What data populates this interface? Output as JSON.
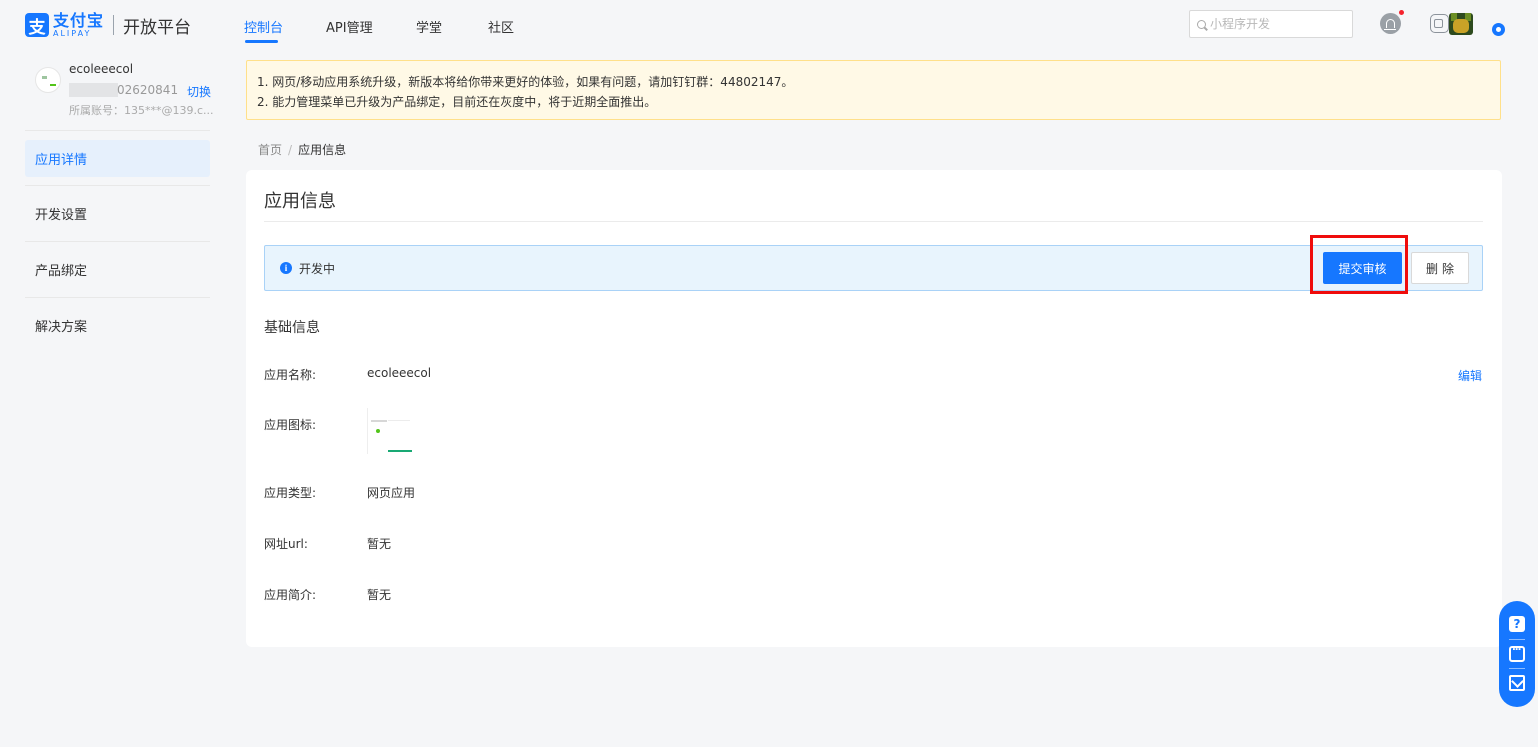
{
  "header": {
    "logo_cn": "支付宝",
    "logo_en": "ALIPAY",
    "logo_mark": "支",
    "platform": "开放平台",
    "nav": [
      {
        "label": "控制台",
        "active": true
      },
      {
        "label": "API管理",
        "active": false
      },
      {
        "label": "学堂",
        "active": false
      },
      {
        "label": "社区",
        "active": false
      }
    ],
    "search_placeholder": "小程序开发",
    "icons": [
      "search-icon",
      "bell-icon",
      "id-card-icon",
      "user-avatar",
      "help-icon"
    ]
  },
  "account": {
    "name": "ecoleeecol",
    "id": "02620841",
    "switch_label": "切换",
    "owner": "所属账号：135***@139.c..."
  },
  "sidebar": {
    "items": [
      {
        "label": "应用详情",
        "active": true
      },
      {
        "label": "开发设置",
        "active": false
      },
      {
        "label": "产品绑定",
        "active": false
      },
      {
        "label": "解决方案",
        "active": false
      }
    ]
  },
  "notice": {
    "lines": [
      "1. 网页/移动应用系统升级，新版本将给你带来更好的体验，如果有问题，请加钉钉群：44802147。",
      "2. 能力管理菜单已升级为产品绑定，目前还在灰度中，将于近期全面推出。"
    ]
  },
  "breadcrumb": {
    "home": "首页",
    "separator": "/",
    "current": "应用信息"
  },
  "main": {
    "title": "应用信息",
    "status": {
      "icon": "info-icon",
      "icon_glyph": "i",
      "text": "开发中",
      "submit_label": "提交审核",
      "delete_label": "删除"
    },
    "section_title": "基础信息",
    "edit_label": "编辑",
    "fields": {
      "name": {
        "label": "应用名称:",
        "value": "ecoleeecol"
      },
      "icon": {
        "label": "应用图标:"
      },
      "type": {
        "label": "应用类型:",
        "value": "网页应用"
      },
      "url": {
        "label": "网址url:",
        "value": "暂无"
      },
      "intro": {
        "label": "应用简介:",
        "value": "暂无"
      }
    }
  },
  "float_widget": {
    "q_glyph": "?",
    "items": [
      "question-icon",
      "chat-icon",
      "feedback-mail-icon"
    ]
  },
  "colors": {
    "brand": "#1677ff",
    "highlight": "#ef0c0c",
    "notice_bg": "#fff9e6",
    "status_bg": "#e8f4fd"
  }
}
